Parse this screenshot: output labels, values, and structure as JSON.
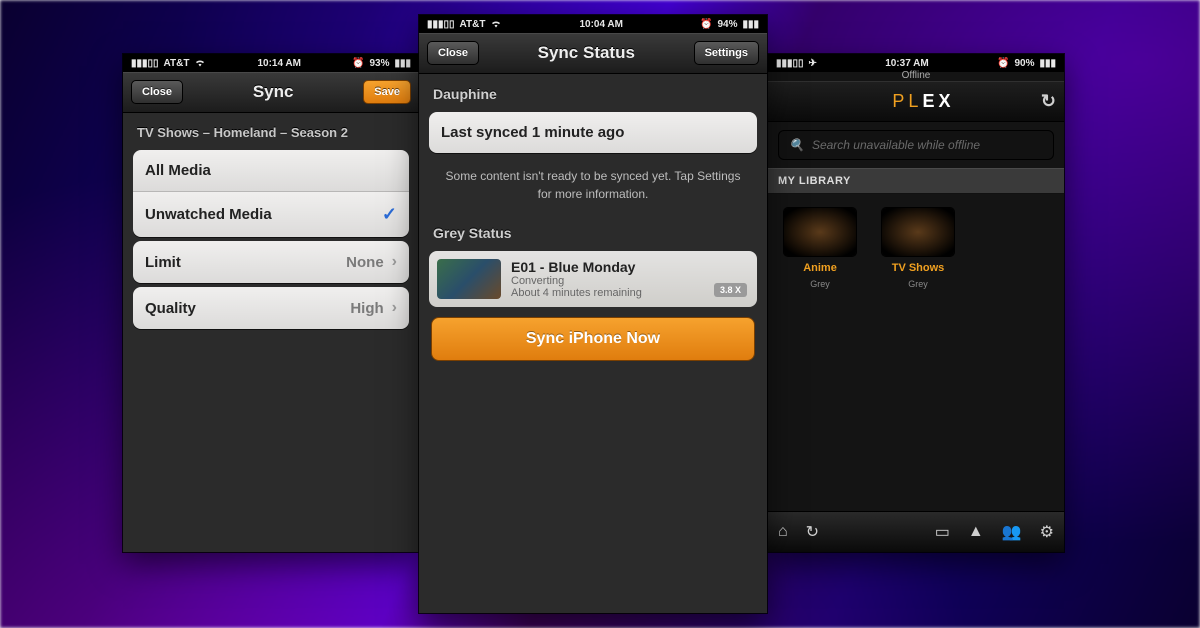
{
  "phones": {
    "left": {
      "status": {
        "carrier": "AT&T",
        "time": "10:14 AM",
        "battery": "93%"
      },
      "nav": {
        "close": "Close",
        "title": "Sync",
        "save": "Save"
      },
      "breadcrumb": "TV Shows – Homeland – Season 2",
      "filters": {
        "all": "All Media",
        "unwatched": "Unwatched Media"
      },
      "limit": {
        "label": "Limit",
        "value": "None"
      },
      "quality": {
        "label": "Quality",
        "value": "High"
      }
    },
    "center": {
      "status": {
        "carrier": "AT&T",
        "time": "10:04 AM",
        "battery": "94%"
      },
      "nav": {
        "close": "Close",
        "title": "Sync Status",
        "settings": "Settings"
      },
      "server1_name": "Dauphine",
      "last_synced": "Last synced 1 minute ago",
      "hint": "Some content isn't ready to be synced yet. Tap Settings for more information.",
      "server2_name": "Grey Status",
      "episode": {
        "title": "E01 - Blue Monday",
        "line2": "Converting",
        "line3": "About 4 minutes remaining",
        "badge": "3.8 X"
      },
      "sync_now": "Sync iPhone Now"
    },
    "right": {
      "status": {
        "carrier": "",
        "time": "10:37 AM",
        "battery": "90%"
      },
      "offline": "Offline",
      "brand_p": "PL",
      "brand_ex": "EX",
      "search_placeholder": "Search unavailable while offline",
      "library_header": "MY LIBRARY",
      "items": [
        {
          "label": "Anime",
          "sub": "Grey"
        },
        {
          "label": "TV Shows",
          "sub": "Grey"
        }
      ]
    }
  }
}
